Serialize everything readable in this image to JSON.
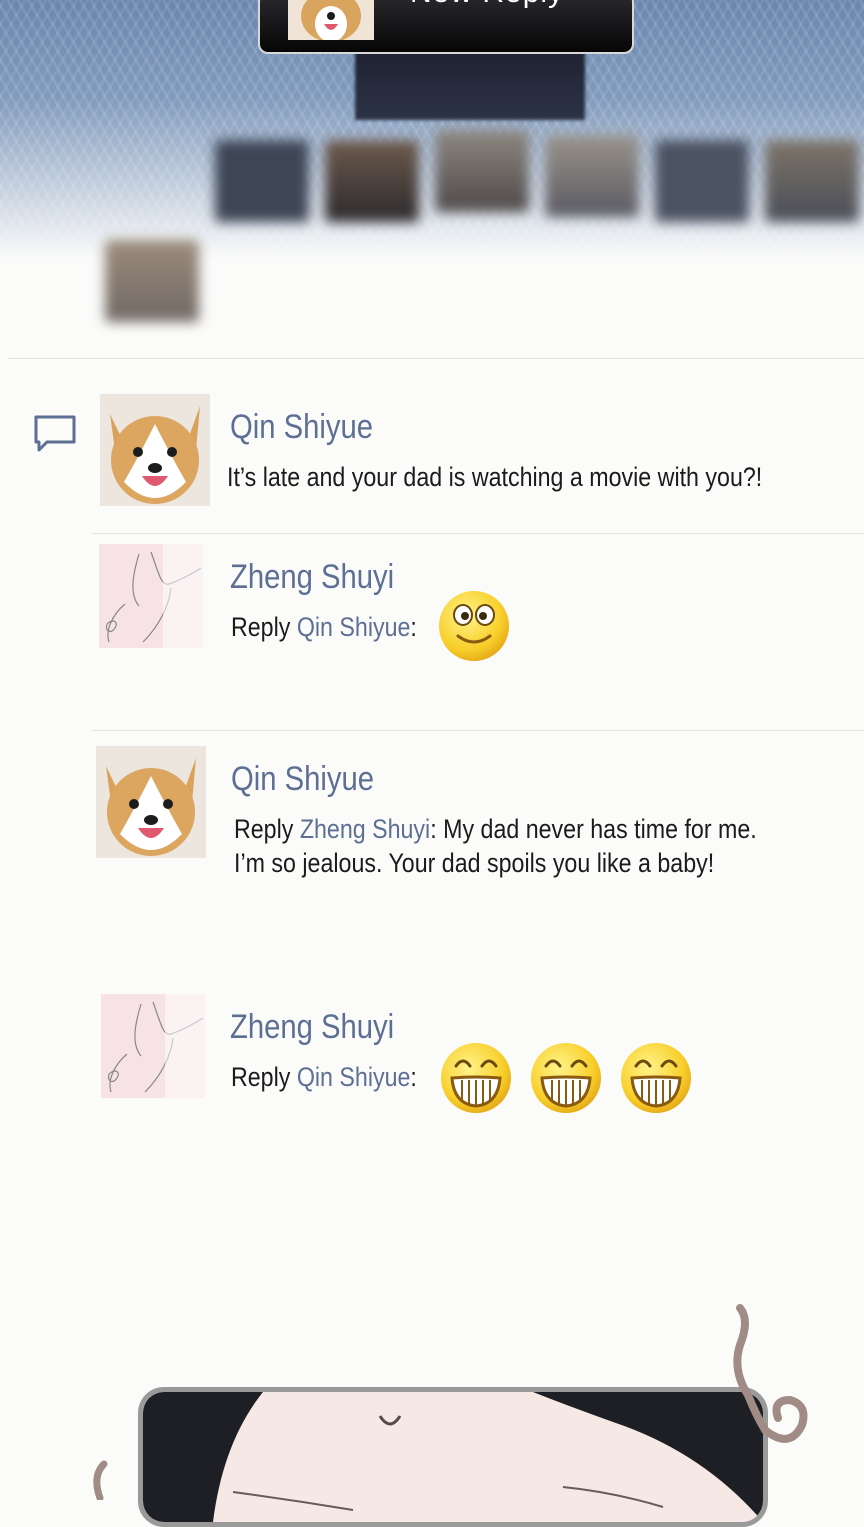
{
  "toast": {
    "title": "New Reply"
  },
  "comments": [
    {
      "author": "Qin Shiyue",
      "text": "It’s late and your dad is watching a movie with you?!"
    },
    {
      "author": "Zheng Shuyi",
      "reply_prefix": "Reply",
      "reply_to": "Qin Shiyue",
      "colon": ":",
      "emoji": [
        "smiling-face"
      ]
    },
    {
      "author": "Qin Shiyue",
      "reply_prefix": "Reply",
      "reply_to": "Zheng Shuyi",
      "colon": ": ",
      "text_line1": "My dad never has time for me.",
      "text_line2": "I’m so jealous. Your dad spoils you like a baby!"
    },
    {
      "author": "Zheng Shuyi",
      "reply_prefix": "Reply",
      "reply_to": "Qin Shiyue",
      "colon": ":",
      "emoji": [
        "grinning-face",
        "grinning-face",
        "grinning-face"
      ]
    }
  ],
  "colors": {
    "accent_name": "#5d6f93",
    "text": "#1b1b1b",
    "background": "#fbfbfa"
  }
}
